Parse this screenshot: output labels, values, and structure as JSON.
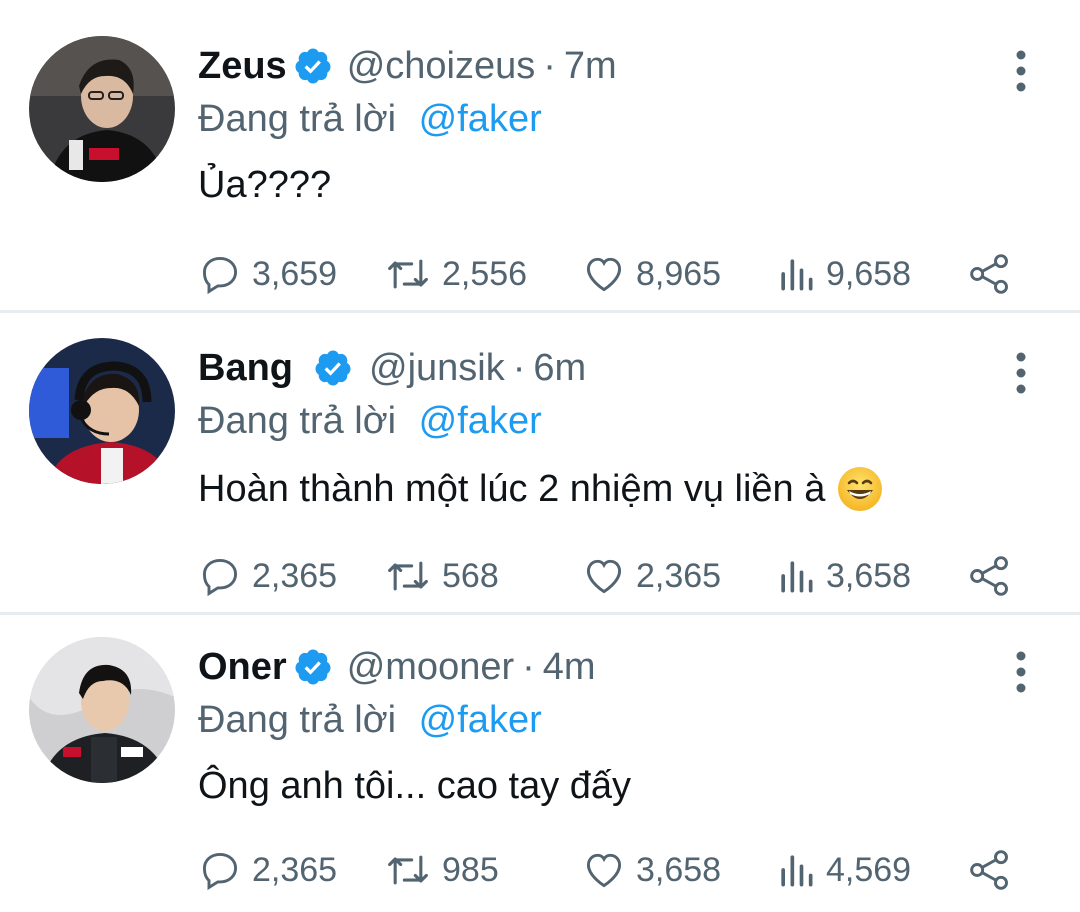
{
  "reply_prefix": "Đang trả lời",
  "colors": {
    "link": "#1d9bf0",
    "secondary": "#536471",
    "verified": "#1d9bf0",
    "divider": "#e6ecf0"
  },
  "icons": [
    "reply-icon",
    "retweet-icon",
    "like-icon",
    "views-icon",
    "share-icon",
    "more-icon",
    "verified-badge-icon"
  ],
  "tweets": [
    {
      "name": "Zeus",
      "handle": "@choizeus",
      "time": "7m",
      "reply_to": "@faker",
      "text": "Ủa????",
      "stats": {
        "replies": "3,659",
        "retweets": "2,556",
        "likes": "8,965",
        "views": "9,658"
      }
    },
    {
      "name": "Bang",
      "handle": "@junsik",
      "time": "6m",
      "reply_to": "@faker",
      "text": "Hoàn thành một lúc 2 nhiệm vụ liền à",
      "emoji": "grinning-face",
      "stats": {
        "replies": "2,365",
        "retweets": "568",
        "likes": "2,365",
        "views": "3,658"
      }
    },
    {
      "name": "Oner",
      "handle": "@mooner",
      "time": "4m",
      "reply_to": "@faker",
      "text": "Ông anh tôi... cao tay đấy",
      "stats": {
        "replies": "2,365",
        "retweets": "985",
        "likes": "3,658",
        "views": "4,569"
      }
    }
  ]
}
